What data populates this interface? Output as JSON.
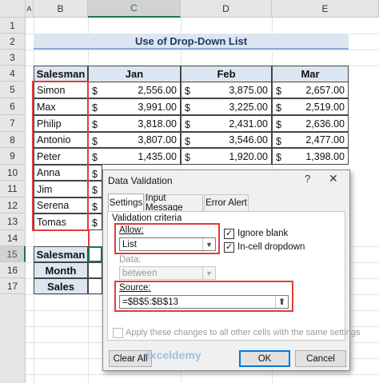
{
  "columns": [
    {
      "label": "A"
    },
    {
      "label": "B"
    },
    {
      "label": "C"
    },
    {
      "label": "D"
    },
    {
      "label": "E"
    }
  ],
  "rows": [
    "1",
    "2",
    "3",
    "4",
    "5",
    "6",
    "7",
    "8",
    "9",
    "10",
    "11",
    "12",
    "13",
    "14",
    "15",
    "16",
    "17"
  ],
  "title": "Use of Drop-Down List",
  "table": {
    "headers": [
      "Salesman",
      "Jan",
      "Feb",
      "Mar"
    ],
    "currency_symbol": "$",
    "rows": [
      {
        "name": "Simon",
        "jan": "2,556.00",
        "feb": "3,875.00",
        "mar": "2,657.00"
      },
      {
        "name": "Max",
        "jan": "3,991.00",
        "feb": "3,225.00",
        "mar": "2,519.00"
      },
      {
        "name": "Philip",
        "jan": "3,818.00",
        "feb": "2,431.00",
        "mar": "2,636.00"
      },
      {
        "name": "Antonio",
        "jan": "3,807.00",
        "feb": "3,546.00",
        "mar": "2,477.00"
      },
      {
        "name": "Peter",
        "jan": "1,435.00",
        "feb": "1,920.00",
        "mar": "1,398.00"
      },
      {
        "name": "Anna",
        "jan": "",
        "feb": "",
        "mar": ""
      },
      {
        "name": "Jim",
        "jan": "",
        "feb": "",
        "mar": ""
      },
      {
        "name": "Serena",
        "jan": "",
        "feb": "",
        "mar": ""
      },
      {
        "name": "Tomas",
        "jan": "",
        "feb": "",
        "mar": ""
      }
    ]
  },
  "lookup": {
    "labels": [
      "Salesman",
      "Month",
      "Sales"
    ]
  },
  "dialog": {
    "title": "Data Validation",
    "help": "?",
    "close": "✕",
    "tabs": [
      "Settings",
      "Input Message",
      "Error Alert"
    ],
    "section_label": "Validation criteria",
    "allow_label": "Allow:",
    "allow_value": "List",
    "data_label": "Data:",
    "data_value": "between",
    "ignore_blank_label": "Ignore blank",
    "ignore_blank_checked": true,
    "incell_label": "In-cell dropdown",
    "incell_checked": true,
    "source_label": "Source:",
    "source_value": "=$B$5:$B$13",
    "apply_label": "Apply these changes to all other cells with the same settings",
    "clear_all": "Clear All",
    "ok": "OK",
    "cancel": "Cancel"
  },
  "watermark": "exceldemy",
  "colors": {
    "accent_red": "#e23b3b",
    "excel_green": "#217346",
    "header_fill": "#dce6f2",
    "default_button_border": "#0078d7"
  }
}
